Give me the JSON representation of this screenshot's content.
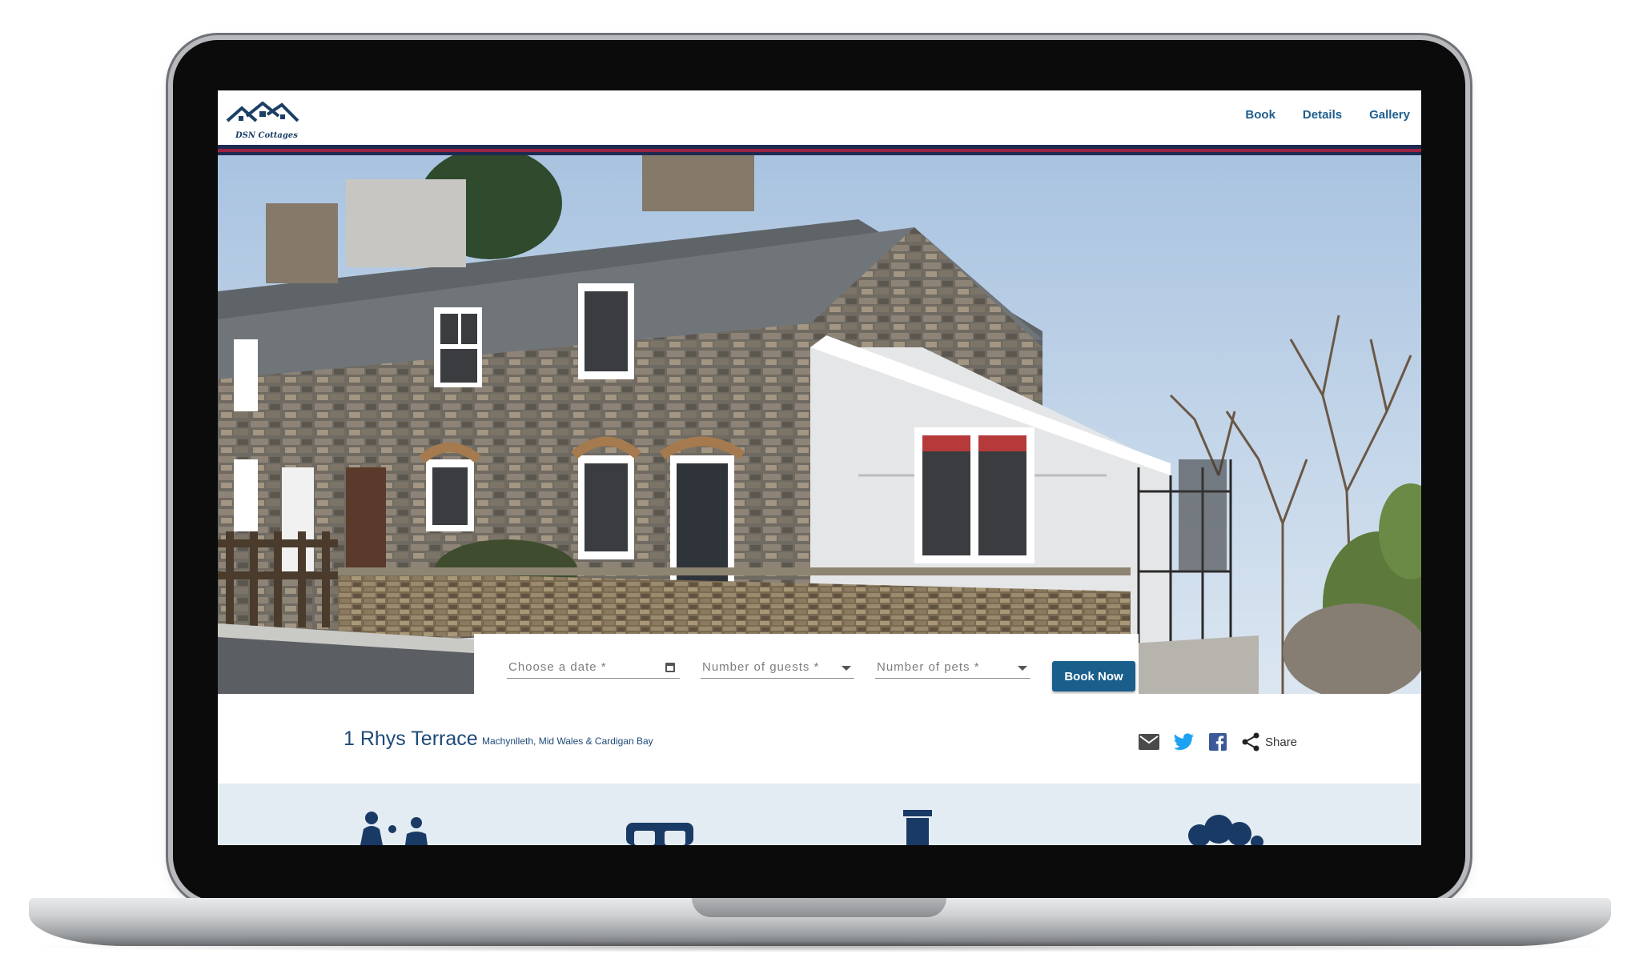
{
  "brand": {
    "logo_text": "DSN Cottages"
  },
  "nav": {
    "items": [
      {
        "label": "Book"
      },
      {
        "label": "Details"
      },
      {
        "label": "Gallery"
      }
    ]
  },
  "booking": {
    "date_placeholder": "Choose a date *",
    "guests_placeholder": "Number of guests *",
    "pets_placeholder": "Number of pets *",
    "book_label": "Book Now"
  },
  "property": {
    "name": "1 Rhys Terrace",
    "location": "Machynlleth, Mid Wales & Cardigan Bay"
  },
  "share": {
    "label": "Share"
  },
  "colors": {
    "accent": "#1a5f8c",
    "stripe_navy": "#1e2a52",
    "stripe_red": "#9a2342",
    "features_bg": "#e3ecf2"
  },
  "icons": [
    "email-icon",
    "twitter-icon",
    "facebook-icon",
    "share-icon",
    "guests-icon",
    "bedroom-icon",
    "bathroom-icon",
    "people-icon"
  ]
}
